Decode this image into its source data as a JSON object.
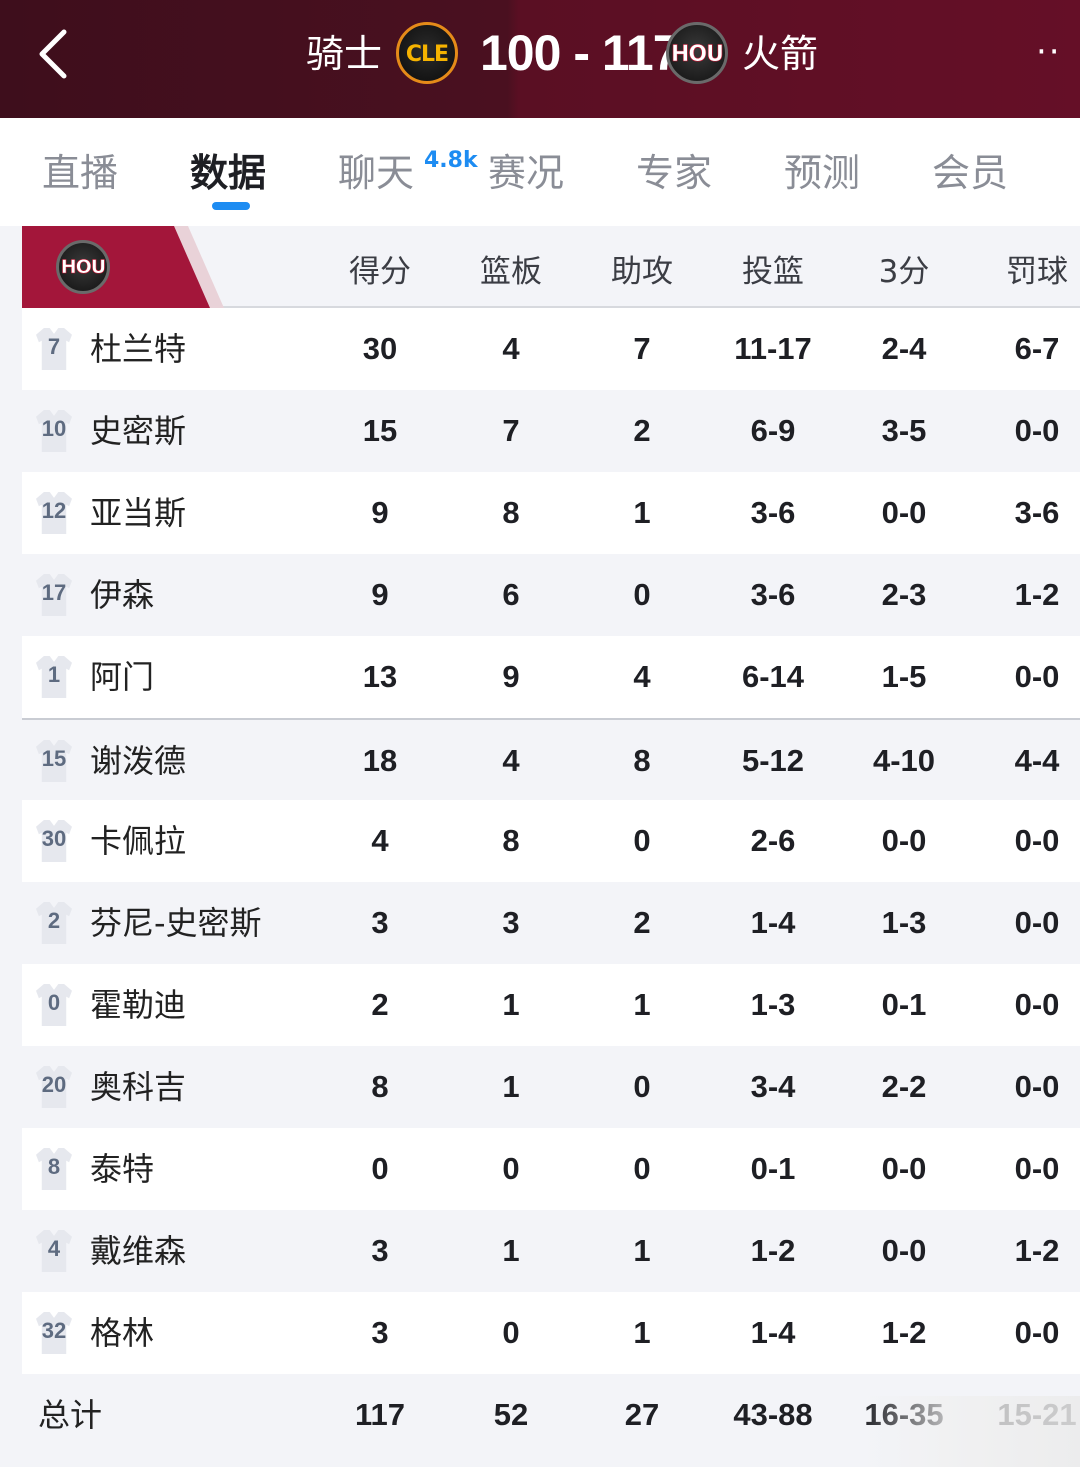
{
  "header": {
    "home_team": "骑士",
    "home_logo_text": "CLE",
    "score": "100 - 117",
    "away_logo_text": "HOU",
    "away_team": "火箭",
    "more_label": "··"
  },
  "tabs": [
    {
      "label": "直播",
      "active": false
    },
    {
      "label": "数据",
      "active": true
    },
    {
      "label": "聊天",
      "active": false,
      "badge": "4.8k"
    },
    {
      "label": "赛况",
      "active": false
    },
    {
      "label": "专家",
      "active": false
    },
    {
      "label": "预测",
      "active": false
    },
    {
      "label": "会员",
      "active": false
    }
  ],
  "table": {
    "team_logo_text": "HOU",
    "columns": [
      "得分",
      "篮板",
      "助攻",
      "投篮",
      "3分",
      "罚球"
    ],
    "players": [
      {
        "num": "7",
        "name": "杜兰特",
        "stats": [
          "30",
          "4",
          "7",
          "11-17",
          "2-4",
          "6-7"
        ]
      },
      {
        "num": "10",
        "name": "史密斯",
        "stats": [
          "15",
          "7",
          "2",
          "6-9",
          "3-5",
          "0-0"
        ]
      },
      {
        "num": "12",
        "name": "亚当斯",
        "stats": [
          "9",
          "8",
          "1",
          "3-6",
          "0-0",
          "3-6"
        ]
      },
      {
        "num": "17",
        "name": "伊森",
        "stats": [
          "9",
          "6",
          "0",
          "3-6",
          "2-3",
          "1-2"
        ]
      },
      {
        "num": "1",
        "name": "阿门",
        "stats": [
          "13",
          "9",
          "4",
          "6-14",
          "1-5",
          "0-0"
        ]
      },
      {
        "num": "15",
        "name": "谢泼德",
        "stats": [
          "18",
          "4",
          "8",
          "5-12",
          "4-10",
          "4-4"
        ]
      },
      {
        "num": "30",
        "name": "卡佩拉",
        "stats": [
          "4",
          "8",
          "0",
          "2-6",
          "0-0",
          "0-0"
        ]
      },
      {
        "num": "2",
        "name": "芬尼-史密斯",
        "stats": [
          "3",
          "3",
          "2",
          "1-4",
          "1-3",
          "0-0"
        ]
      },
      {
        "num": "0",
        "name": "霍勒迪",
        "stats": [
          "2",
          "1",
          "1",
          "1-3",
          "0-1",
          "0-0"
        ]
      },
      {
        "num": "20",
        "name": "奥科吉",
        "stats": [
          "8",
          "1",
          "0",
          "3-4",
          "2-2",
          "0-0"
        ]
      },
      {
        "num": "8",
        "name": "泰特",
        "stats": [
          "0",
          "0",
          "0",
          "0-1",
          "0-0",
          "0-0"
        ]
      },
      {
        "num": "4",
        "name": "戴维森",
        "stats": [
          "3",
          "1",
          "1",
          "1-2",
          "0-0",
          "1-2"
        ]
      },
      {
        "num": "32",
        "name": "格林",
        "stats": [
          "3",
          "0",
          "1",
          "1-4",
          "1-2",
          "0-0"
        ]
      }
    ],
    "total": {
      "label": "总计",
      "stats": [
        "117",
        "52",
        "27",
        "43-88",
        "16-35",
        "15-21"
      ]
    }
  },
  "colors": {
    "header_bg": "#4a1020",
    "accent": "#1d8cf2",
    "team_tab": "#a3163a"
  }
}
